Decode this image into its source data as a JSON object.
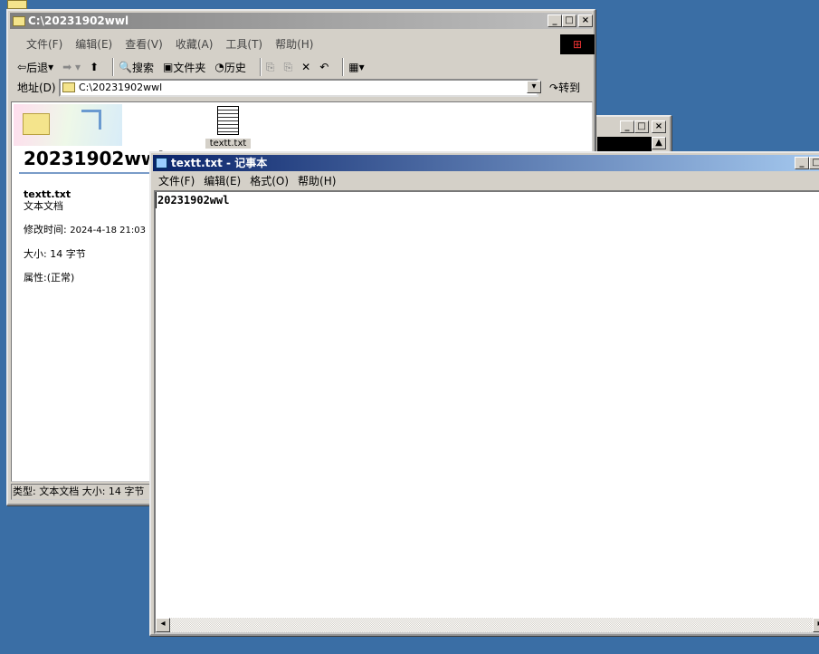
{
  "explorer": {
    "title": "C:\\20231902wwl",
    "menu": [
      "文件(F)",
      "编辑(E)",
      "查看(V)",
      "收藏(A)",
      "工具(T)",
      "帮助(H)"
    ],
    "toolbar": {
      "back": "后退",
      "search": "搜索",
      "folders": "文件夹",
      "history": "历史"
    },
    "address_label": "地址(D)",
    "address_value": "C:\\20231902wwl",
    "go_label": "转到",
    "folder_name": "20231902wwl",
    "details": {
      "name": "textt.txt",
      "type": "文本文档",
      "modified_label": "修改时间:",
      "modified": "2024-4-18 21:03",
      "size_label": "大小:",
      "size": "14 字节",
      "attr_label": "属性:",
      "attr": "(正常)"
    },
    "file_icon_label": "textt.txt",
    "status": "类型: 文本文档 大小: 14 字节"
  },
  "notepad": {
    "title": "textt.txt - 记事本",
    "menu": [
      "文件(F)",
      "编辑(E)",
      "格式(O)",
      "帮助(H)"
    ],
    "content": "20231902wwl"
  },
  "colors": {
    "desktop": "#3a6ea5",
    "title_active_start": "#0a246a",
    "title_active_end": "#a6caf0"
  }
}
